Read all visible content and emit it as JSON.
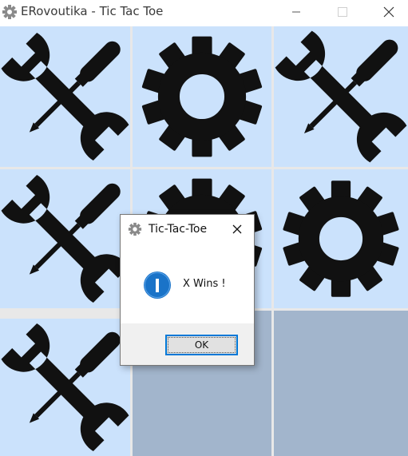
{
  "window": {
    "title": "ERovoutika - Tic Tac Toe",
    "icon": "gear-icon",
    "controls": [
      "minimize",
      "maximize",
      "close"
    ]
  },
  "board": {
    "cells": [
      {
        "row": 1,
        "col": 1,
        "mark": "X",
        "icon": "wrench-screwdriver-icon"
      },
      {
        "row": 1,
        "col": 2,
        "mark": "O",
        "icon": "gear-icon"
      },
      {
        "row": 1,
        "col": 3,
        "mark": "X",
        "icon": "wrench-screwdriver-icon"
      },
      {
        "row": 2,
        "col": 1,
        "mark": "X",
        "icon": "wrench-screwdriver-icon"
      },
      {
        "row": 2,
        "col": 2,
        "mark": "O",
        "icon": "gear-icon"
      },
      {
        "row": 2,
        "col": 3,
        "mark": "O",
        "icon": "gear-icon"
      },
      {
        "row": 3,
        "col": 1,
        "mark": "X",
        "icon": "wrench-screwdriver-icon"
      },
      {
        "row": 3,
        "col": 2,
        "mark": "",
        "icon": ""
      },
      {
        "row": 3,
        "col": 3,
        "mark": "",
        "icon": ""
      }
    ],
    "colors": {
      "x_cell": "#cbe2fc",
      "o_cell": "#cbe2fc",
      "empty_cell": "#a2b5cc",
      "icon": "#111111"
    }
  },
  "dialog": {
    "title": "Tic-Tac-Toe",
    "message": "X Wins !",
    "ok_label": "OK",
    "icon": "info-icon",
    "accent": "#0078d7"
  }
}
